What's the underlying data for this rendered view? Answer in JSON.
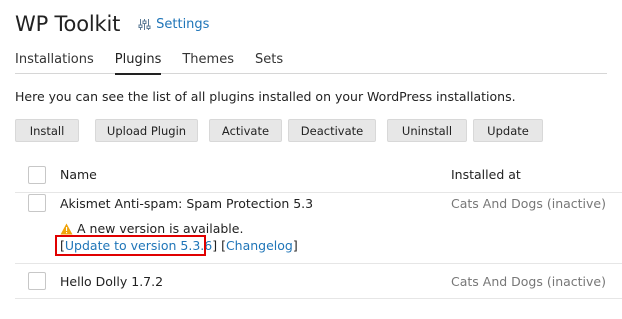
{
  "header": {
    "title": "WP Toolkit",
    "settings_label": "Settings"
  },
  "tabs": [
    {
      "label": "Installations",
      "active": false
    },
    {
      "label": "Plugins",
      "active": true
    },
    {
      "label": "Themes",
      "active": false
    },
    {
      "label": "Sets",
      "active": false
    }
  ],
  "description": "Here you can see the list of all plugins installed on your WordPress installations.",
  "toolbar": {
    "install": "Install",
    "upload": "Upload Plugin",
    "activate": "Activate",
    "deactivate": "Deactivate",
    "uninstall": "Uninstall",
    "update": "Update"
  },
  "table": {
    "col_name": "Name",
    "col_installed": "Installed at",
    "rows": [
      {
        "name": "Akismet Anti-spam: Spam Protection 5.3",
        "installed_at": "Cats And Dogs (inactive)",
        "notice": "A new version is available.",
        "bracket_open": "[",
        "update_link": "Update to version 5.3.6",
        "bracket_mid": "] [",
        "changelog_link": "Changelog",
        "bracket_close": "]"
      },
      {
        "name": "Hello Dolly 1.7.2",
        "installed_at": "Cats And Dogs (inactive)"
      }
    ]
  },
  "colors": {
    "link": "#1f75b8",
    "warning": "#f0a30a",
    "highlight": "#e00000"
  }
}
